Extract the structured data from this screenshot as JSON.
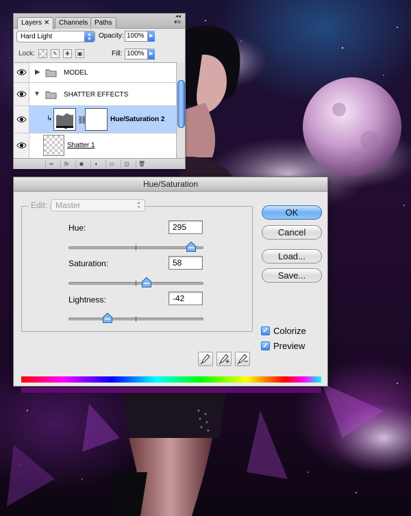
{
  "layers_panel": {
    "tabs": [
      {
        "label": "Layers",
        "active": true,
        "closable": true
      },
      {
        "label": "Channels",
        "active": false
      },
      {
        "label": "Paths",
        "active": false
      }
    ],
    "blend_mode": "Hard Light",
    "opacity_label": "Opacity:",
    "opacity_value": "100%",
    "lock_label": "Lock:",
    "fill_label": "Fill:",
    "fill_value": "100%",
    "layers": [
      {
        "name": "MODEL",
        "type": "group",
        "expanded": false,
        "visible": true
      },
      {
        "name": "SHATTER EFFECTS",
        "type": "group",
        "expanded": true,
        "visible": true
      },
      {
        "name": "Hue/Saturation 2",
        "type": "adjustment",
        "selected": true,
        "visible": true,
        "clipped": true
      },
      {
        "name": "Shatter 1",
        "type": "pixel",
        "visible": true
      }
    ],
    "footer_icons": [
      "link-icon",
      "fx-icon",
      "mask-icon",
      "adjustment-icon",
      "group-icon",
      "new-layer-icon",
      "trash-icon"
    ]
  },
  "dialog": {
    "title": "Hue/Saturation",
    "edit_label": "Edit:",
    "edit_value": "Master",
    "hue": {
      "label": "Hue:",
      "value": "295",
      "level": 0.91
    },
    "saturation": {
      "label": "Saturation:",
      "value": "58",
      "level": 0.58
    },
    "lightness": {
      "label": "Lightness:",
      "value": "-42",
      "level": 0.29
    },
    "buttons": {
      "ok": "OK",
      "cancel": "Cancel",
      "load": "Load...",
      "save": "Save..."
    },
    "colorize": {
      "label": "Colorize",
      "checked": true
    },
    "preview": {
      "label": "Preview",
      "checked": true
    },
    "result_color": "#5e0b6e"
  },
  "colors": {
    "accent": "#3b7ce6",
    "selection": "#b5d3fd",
    "result": "#5e0b6e"
  }
}
